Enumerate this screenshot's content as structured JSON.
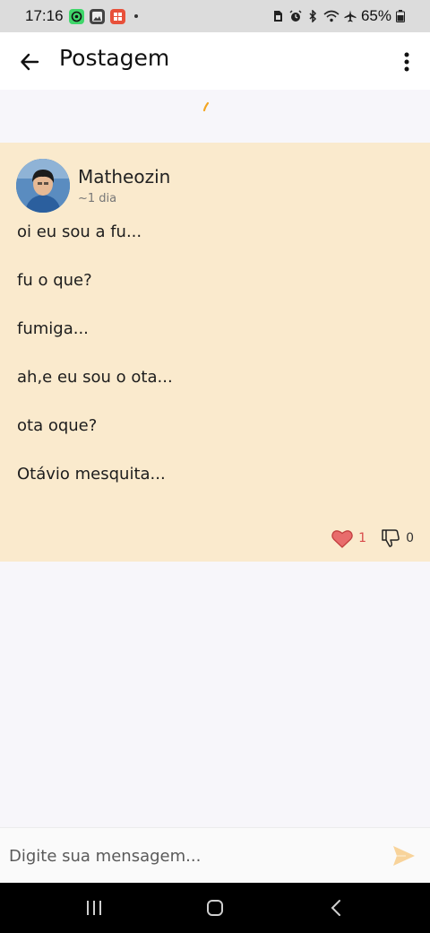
{
  "status_bar": {
    "time": "17:16",
    "battery_percent": "65%",
    "icons": [
      "whatsapp-icon",
      "gallery-icon",
      "app-notification-icon",
      "sim-icon",
      "alarm-icon",
      "bluetooth-icon",
      "wifi-icon",
      "airplane-icon",
      "battery-icon"
    ]
  },
  "app_bar": {
    "title": "Postagem",
    "back_icon": "arrow-left-icon",
    "menu_icon": "more-vertical-icon"
  },
  "post": {
    "author": "Matheozin",
    "time_ago": "~1 dia",
    "lines": [
      "oi eu sou a fu...",
      "fu o que?",
      "fumiga...",
      "ah,e eu sou o ota...",
      "ota oque?",
      "Otávio mesquita..."
    ],
    "likes": "1",
    "dislikes": "0"
  },
  "composer": {
    "placeholder": "Digite sua mensagem...",
    "send_icon": "send-icon"
  },
  "colors": {
    "card_background": "#faeacd",
    "accent_orange": "#f3a521",
    "like_red": "#d84b4b",
    "send_disabled": "#f8d39a"
  },
  "nav_bar": {
    "buttons": [
      "recent-apps-icon",
      "home-icon",
      "back-icon"
    ]
  }
}
